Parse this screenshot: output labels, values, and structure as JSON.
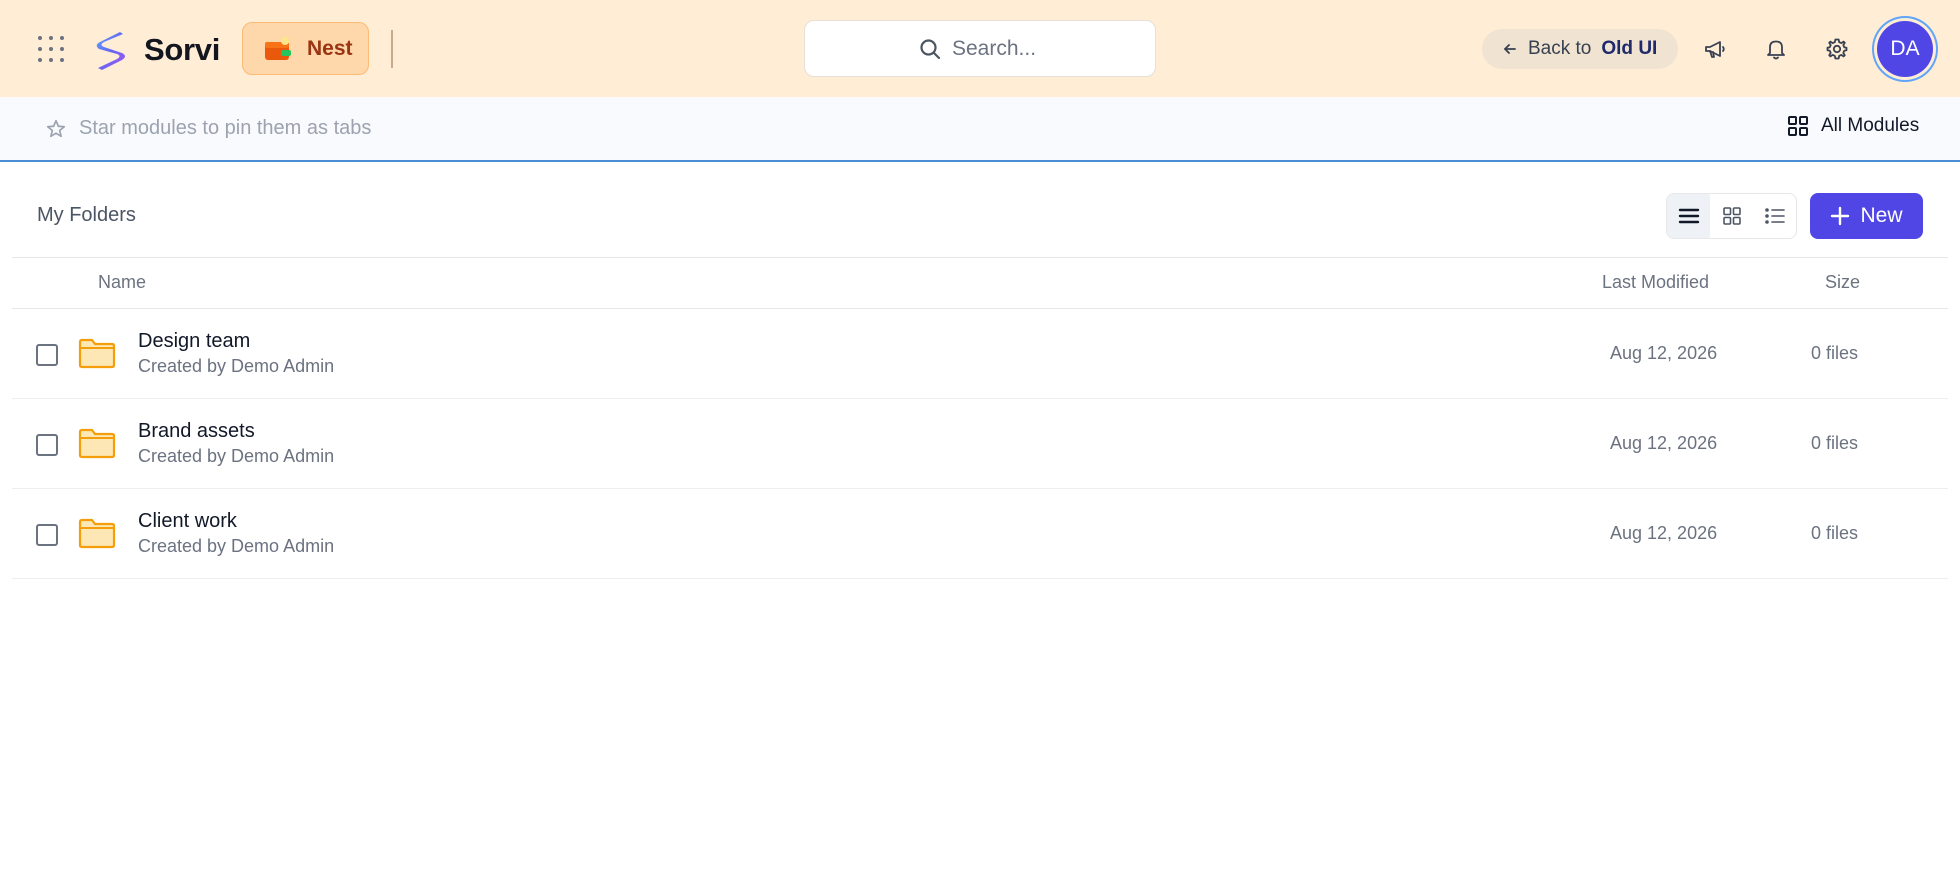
{
  "header": {
    "brand_name": "Sorvi",
    "module_name": "Nest",
    "search_placeholder": "Search...",
    "back_prefix": "Back to",
    "back_target": "Old UI",
    "avatar_initials": "DA"
  },
  "pinbar": {
    "hint": "Star modules to pin them as tabs",
    "all_modules_label": "All Modules"
  },
  "content": {
    "title": "My Folders",
    "new_label": "New"
  },
  "table": {
    "columns": {
      "name": "Name",
      "last_modified": "Last Modified",
      "size": "Size"
    },
    "rows": [
      {
        "name": "Design team",
        "subtitle": "Created by Demo Admin",
        "modified": "Aug 12, 2026",
        "size": "0 files"
      },
      {
        "name": "Brand assets",
        "subtitle": "Created by Demo Admin",
        "modified": "Aug 12, 2026",
        "size": "0 files"
      },
      {
        "name": "Client work",
        "subtitle": "Created by Demo Admin",
        "modified": "Aug 12, 2026",
        "size": "0 files"
      }
    ]
  },
  "colors": {
    "header_bg": "#ffedd5",
    "accent": "#4f46e5",
    "folder": "#f59e0b",
    "pin_border": "#4a8fd4"
  },
  "icons": [
    "apps-grid-icon",
    "sorvi-logo-icon",
    "nest-wallet-icon",
    "search-icon",
    "arrow-left-icon",
    "megaphone-icon",
    "bell-icon",
    "gear-icon",
    "star-icon",
    "grid-icon",
    "list-icon",
    "plus-icon",
    "folder-icon"
  ]
}
